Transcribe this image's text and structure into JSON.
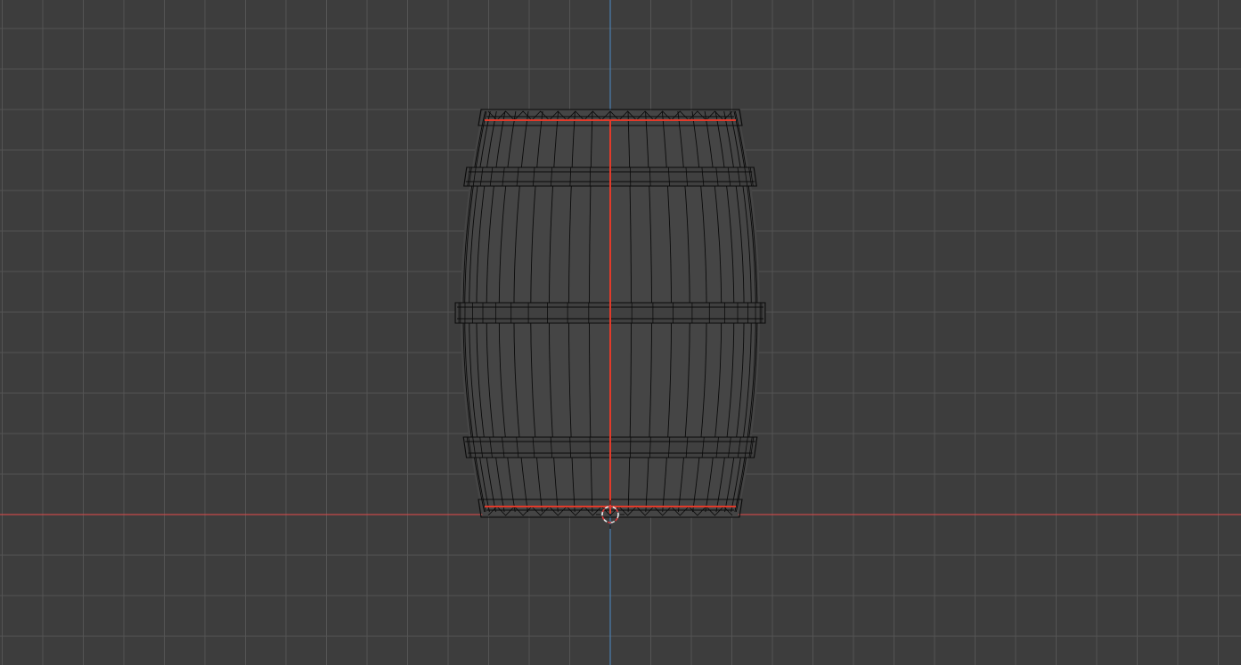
{
  "app": {
    "view": "3d-viewport",
    "mode": "wireframe",
    "projection": "orthographic-front"
  },
  "viewport": {
    "background_color": "#3d3d3d",
    "grid_color": "#545454",
    "grid_major_color": "#5a5a5a",
    "x_axis_color": "#c44a4a",
    "z_axis_color": "#4a7ba8",
    "wire_color": "#0a0a0a",
    "selection_color": "#e23a2a",
    "cursor_color": "#e8e8e8",
    "cursor_accent_color": "#d83a3a"
  },
  "objects": [
    {
      "name_icon": "barrel-mesh",
      "type": "mesh",
      "shading": "wireframe",
      "selected_edge_loops": 3
    }
  ],
  "icons": {
    "cursor": "3d-cursor-icon"
  }
}
